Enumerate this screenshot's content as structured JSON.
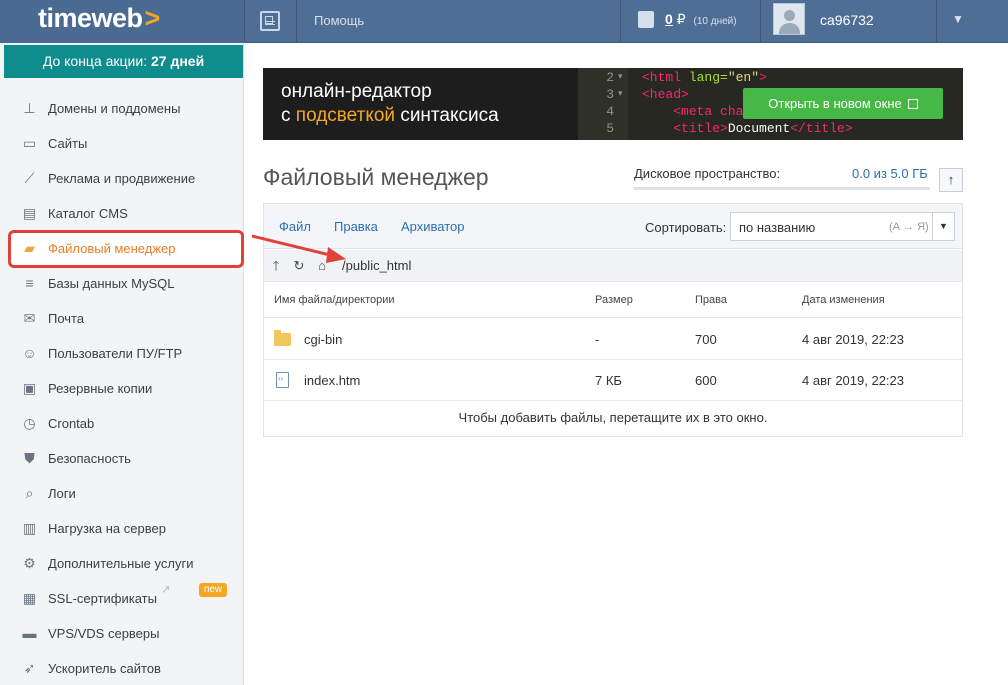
{
  "header": {
    "logo": "timeweb",
    "logo_chevron": ">",
    "help_label": "Помощь",
    "balance_value": "0",
    "currency": "₽",
    "balance_days": "(10 дней)",
    "username": "ca96732",
    "caret": "▼"
  },
  "sidebar": {
    "promo_prefix": "До конца акции:",
    "promo_days": "27 дней",
    "items": [
      {
        "label": "Домены и поддомены",
        "icon": "sitemap-icon",
        "glyph": "⊥"
      },
      {
        "label": "Сайты",
        "icon": "window-icon",
        "glyph": "▭"
      },
      {
        "label": "Реклама и продвижение",
        "icon": "chart-icon",
        "glyph": "⟋"
      },
      {
        "label": "Каталог CMS",
        "icon": "catalog-icon",
        "glyph": "▤"
      },
      {
        "label": "Файловый менеджер",
        "icon": "folder-icon",
        "glyph": "▰",
        "active": true
      },
      {
        "label": "Базы данных MySQL",
        "icon": "database-icon",
        "glyph": "≡"
      },
      {
        "label": "Почта",
        "icon": "mailbox-icon",
        "glyph": "✉"
      },
      {
        "label": "Пользователи ПУ/FTP",
        "icon": "users-icon",
        "glyph": "☺"
      },
      {
        "label": "Резервные копии",
        "icon": "backup-icon",
        "glyph": "▣"
      },
      {
        "label": "Crontab",
        "icon": "clock-icon",
        "glyph": "◷"
      },
      {
        "label": "Безопасность",
        "icon": "shield-icon",
        "glyph": "⛊"
      },
      {
        "label": "Логи",
        "icon": "log-icon",
        "glyph": "⌕"
      },
      {
        "label": "Нагрузка на сервер",
        "icon": "load-icon",
        "glyph": "▥"
      },
      {
        "label": "Дополнительные услуги",
        "icon": "gear-icon",
        "glyph": "⚙"
      },
      {
        "label": "SSL-сертификаты",
        "icon": "certificate-icon",
        "glyph": "▦"
      },
      {
        "label": "VPS/VDS серверы",
        "icon": "server-icon",
        "glyph": "▬"
      },
      {
        "label": "Ускоритель сайтов",
        "icon": "rocket-icon",
        "glyph": "➶"
      }
    ],
    "new_badge": "new"
  },
  "banner": {
    "line1": "онлайн-редактор",
    "line2_prefix": "с",
    "line2_highlight": "подсветкой",
    "line2_suffix": "синтаксиса",
    "code_lines": [
      {
        "num": "2",
        "fold": "▾",
        "parts": [
          [
            "t-tag",
            "<html "
          ],
          [
            "t-attr",
            "lang="
          ],
          [
            "t-str",
            "\"en\""
          ],
          [
            "t-tag",
            ">"
          ]
        ]
      },
      {
        "num": "3",
        "fold": "▾",
        "parts": [
          [
            "t-tag",
            "<head>"
          ]
        ]
      },
      {
        "num": "4",
        "fold": "",
        "parts": [
          [
            "",
            "    "
          ],
          [
            "t-tag",
            "<meta cha"
          ]
        ]
      },
      {
        "num": "5",
        "fold": "",
        "parts": [
          [
            "",
            "    "
          ],
          [
            "t-tag",
            "<title>"
          ],
          [
            "",
            "Document"
          ],
          [
            "t-tag",
            "</title>"
          ]
        ]
      }
    ],
    "open_button": "Открыть в новом окне"
  },
  "page": {
    "title": "Файловый менеджер",
    "disk_label": "Дисковое пространство:",
    "disk_value": "0.0 из 5.0 ГБ",
    "disk_used_fraction": 0.0
  },
  "file_manager": {
    "menu": [
      "Файл",
      "Правка",
      "Архиватор"
    ],
    "sort_label": "Сортировать:",
    "sort_value": "по названию",
    "sort_hint": "(А → Я)",
    "path": "/public_html",
    "columns": [
      "Имя файла/директории",
      "Размер",
      "Права",
      "Дата изменения"
    ],
    "rows": [
      {
        "name": "cgi-bin",
        "size": "-",
        "perms": "700",
        "date": "4 авг 2019, 22:23",
        "type": "folder"
      },
      {
        "name": "index.htm",
        "size": "7 КБ",
        "perms": "600",
        "date": "4 авг 2019, 22:23",
        "type": "file"
      }
    ],
    "drop_hint": "Чтобы добавить файлы, перетащите их в это окно."
  },
  "colors": {
    "topbar": "#4e6e95",
    "promo": "#0f8c8c",
    "accent_orange": "#e67e22",
    "highlight_red": "#e0413a",
    "button_green": "#45b845",
    "link_blue": "#2a6fb0"
  }
}
